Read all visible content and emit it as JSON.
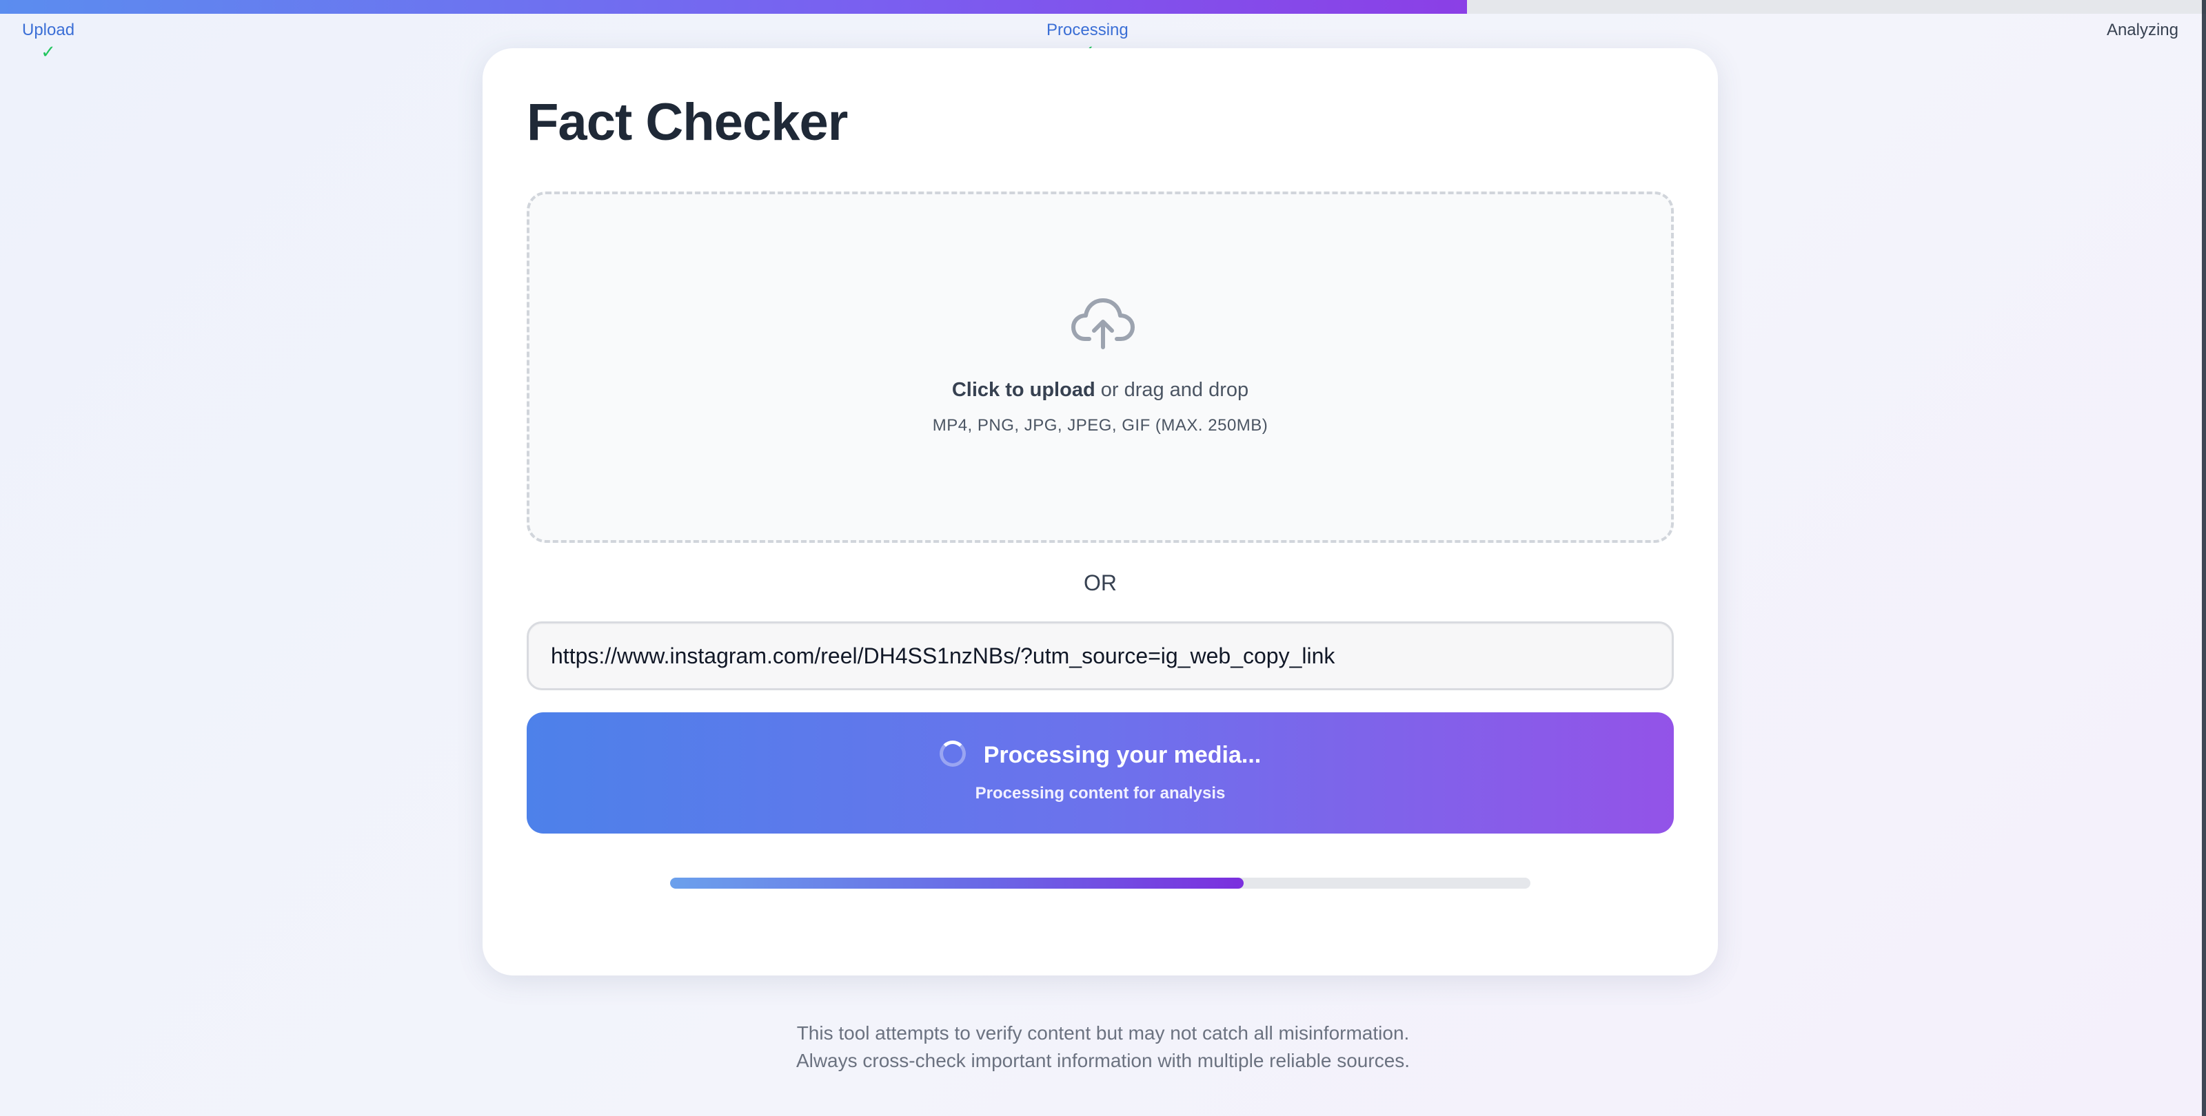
{
  "steps": {
    "upload": {
      "label": "Upload",
      "done": true
    },
    "processing": {
      "label": "Processing",
      "done": true
    },
    "analyzing": {
      "label": "Analyzing",
      "done": false
    }
  },
  "top_progress_fraction": 0.665,
  "card": {
    "title": "Fact Checker",
    "dropzone": {
      "icon": "cloud-upload-icon",
      "upload_bold": "Click to upload",
      "upload_rest": " or drag and drop",
      "formats": "MP4, PNG, JPG, JPEG, GIF (MAX. 250MB)"
    },
    "or_label": "OR",
    "url_input": {
      "value": "https://www.instagram.com/reel/DH4SS1nzNBs/?utm_source=ig_web_copy_link",
      "placeholder": ""
    },
    "button": {
      "label": "Processing your media...",
      "sublabel": "Processing content for analysis"
    },
    "progress_fraction": 0.667
  },
  "disclaimer": {
    "line1": "This tool attempts to verify content but may not catch all misinformation.",
    "line2": "Always cross-check important information with multiple reliable sources."
  },
  "colors": {
    "accent_start": "#4d81ea",
    "accent_end": "#9353e8",
    "step_done": "#3b6fd6",
    "check": "#22c55e"
  }
}
